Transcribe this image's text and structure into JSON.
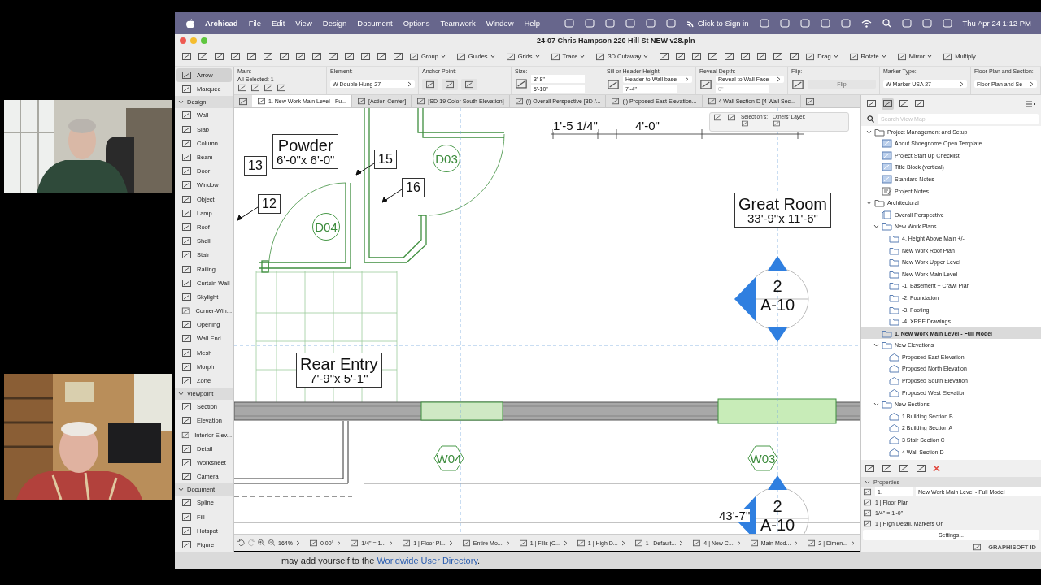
{
  "menubar": {
    "app": "Archicad",
    "menus": [
      "File",
      "Edit",
      "View",
      "Design",
      "Document",
      "Options",
      "Teamwork",
      "Window",
      "Help"
    ],
    "sign_in": "Click to Sign in",
    "clock": "Thu Apr 24 1:12 PM"
  },
  "window": {
    "title": "24-07 Chris Hampson 220 Hill St NEW v28.pln"
  },
  "toolbar": {
    "buttons": [
      "Group",
      "Guides",
      "Grids",
      "Trace",
      "3D Cutaway",
      "Drag",
      "Rotate",
      "Mirror",
      "Multiply..."
    ]
  },
  "info_box": {
    "sections": [
      {
        "kind": "main",
        "label": "Main:",
        "value": "All Selected: 1"
      },
      {
        "kind": "select",
        "label": "Element:",
        "value": "W Double Hung 27"
      },
      {
        "kind": "anchor",
        "label": "Anchor Point:"
      },
      {
        "kind": "fields",
        "label": "Size:",
        "values": [
          "3'-8\"",
          "5'-10\""
        ]
      },
      {
        "kind": "select-field",
        "label": "Sill or Header Height:",
        "value": "Header to Wall base",
        "field": "7'-4\""
      },
      {
        "kind": "select-field",
        "label": "Reveal Depth:",
        "value": "Reveal to Wall Face",
        "placeholder": "0\""
      },
      {
        "kind": "disabled",
        "label": "Flip:",
        "value": "Flip"
      },
      {
        "kind": "select",
        "label": "Marker Type:",
        "value": "W Marker USA 27"
      },
      {
        "kind": "select",
        "label": "Floor Plan and Section:",
        "value": "Floor Plan and Se"
      }
    ]
  },
  "tabs": [
    {
      "label": "1. New Work Main Level - Fu...",
      "selected": true
    },
    {
      "label": "[Action Center]",
      "selected": false
    },
    {
      "label": "[SD-19 Color South Elevation]",
      "selected": false
    },
    {
      "label": "(!) Overall Perspective [3D /...",
      "selected": false
    },
    {
      "label": "(!) Proposed East Elevation...",
      "selected": false
    },
    {
      "label": "4 Wall Section D [4 Wall Sec...",
      "selected": false
    }
  ],
  "toolbox": {
    "items": [
      {
        "label": "Arrow",
        "selected": true
      },
      {
        "label": "Marquee",
        "selected": false
      }
    ],
    "groups": [
      {
        "label": "Design",
        "expanded": true,
        "items": [
          {
            "label": "Wall",
            "selected": false
          },
          {
            "label": "Slab",
            "selected": false
          },
          {
            "label": "Column",
            "selected": false
          },
          {
            "label": "Beam",
            "selected": false
          },
          {
            "label": "Door",
            "selected": false
          },
          {
            "label": "Window",
            "selected": false
          },
          {
            "label": "Object",
            "selected": false
          },
          {
            "label": "Lamp",
            "selected": false
          },
          {
            "label": "Roof",
            "selected": false
          },
          {
            "label": "Shell",
            "selected": false
          },
          {
            "label": "Stair",
            "selected": false
          },
          {
            "label": "Railing",
            "selected": false
          },
          {
            "label": "Curtain Wall",
            "selected": false
          },
          {
            "label": "Skylight",
            "selected": false
          },
          {
            "label": "Corner-Win...",
            "selected": false
          },
          {
            "label": "Opening",
            "selected": false
          },
          {
            "label": "Wall End",
            "selected": false
          },
          {
            "label": "Mesh",
            "selected": false
          },
          {
            "label": "Morph",
            "selected": false
          },
          {
            "label": "Zone",
            "selected": false
          }
        ]
      },
      {
        "label": "Viewpoint",
        "expanded": true,
        "items": [
          {
            "label": "Section",
            "selected": false
          },
          {
            "label": "Elevation",
            "selected": false
          },
          {
            "label": "Interior Elev...",
            "selected": false
          },
          {
            "label": "Detail",
            "selected": false
          },
          {
            "label": "Worksheet",
            "selected": false
          },
          {
            "label": "Camera",
            "selected": false
          }
        ]
      },
      {
        "label": "Document",
        "expanded": true,
        "items": [
          {
            "label": "Spline",
            "selected": false
          },
          {
            "label": "Fill",
            "selected": false
          },
          {
            "label": "Hotspot",
            "selected": false
          },
          {
            "label": "Figure",
            "selected": false
          }
        ]
      }
    ]
  },
  "canvas": {
    "overlay": {
      "selection_label": "Selection's:",
      "layer_label": "Others' Layer:"
    },
    "labels": [
      {
        "kind": "room",
        "name": "Powder",
        "size": "6'-0\"x 6'-0\""
      },
      {
        "kind": "tag",
        "text": "13"
      },
      {
        "kind": "tag",
        "text": "15"
      },
      {
        "kind": "tag",
        "text": "16"
      },
      {
        "kind": "tag",
        "text": "12"
      },
      {
        "kind": "door",
        "text": "D03"
      },
      {
        "kind": "door",
        "text": "D04"
      },
      {
        "kind": "dimension",
        "text": "1'-5 1/4\""
      },
      {
        "kind": "dimension",
        "text": "4'-0\""
      },
      {
        "kind": "room",
        "name": "Great Room",
        "size": "33'-9\"x 11'-6\""
      },
      {
        "kind": "marker",
        "number": "2",
        "sheet": "A-10"
      },
      {
        "kind": "room",
        "name": "Rear Entry",
        "size": "7'-9\"x 5'-1\""
      },
      {
        "kind": "window",
        "text": "W04"
      },
      {
        "kind": "window",
        "text": "W03"
      },
      {
        "kind": "dimension",
        "text": "43'-7\""
      },
      {
        "kind": "marker",
        "number": "2",
        "sheet": "A-10"
      }
    ]
  },
  "status_bar": {
    "items": [
      "164%",
      "0.00°",
      "1/4\" = 1...",
      "1 | Floor Pl...",
      "Entire Mo...",
      "1 | Fills (C...",
      "1 | High D...",
      "1 | Default...",
      "4 | New C...",
      "Main Mod...",
      "2 | Dimen..."
    ]
  },
  "navigator": {
    "search_placeholder": "Search View Map",
    "tree": [
      {
        "label": "Project Management and Setup",
        "kind": "folder",
        "expanded": true,
        "selected": false,
        "children": [
          {
            "label": "About Shoegnome Open Template",
            "kind": "sheet",
            "selected": false
          },
          {
            "label": "Project Start Up Checklist",
            "kind": "sheet",
            "selected": false
          },
          {
            "label": "Title Block (vertical)",
            "kind": "sheet",
            "selected": false
          },
          {
            "label": "Standard Notes",
            "kind": "sheet",
            "selected": false
          },
          {
            "label": "Project Notes",
            "kind": "notes",
            "selected": false
          }
        ]
      },
      {
        "label": "Architectural",
        "kind": "folder",
        "expanded": true,
        "selected": false,
        "children": [
          {
            "label": "Overall Perspective",
            "kind": "perspective",
            "selected": false
          },
          {
            "label": "New Work Plans",
            "kind": "plan",
            "expanded": true,
            "selected": false,
            "children": [
              {
                "label": "4. Height Above Main +/-",
                "kind": "plan",
                "selected": false
              },
              {
                "label": "New Work Roof Plan",
                "kind": "plan",
                "selected": false
              },
              {
                "label": "New Work Upper Level",
                "kind": "plan",
                "selected": false
              },
              {
                "label": "New Work Main Level",
                "kind": "plan",
                "selected": false
              },
              {
                "label": "-1. Basement + Crawl Plan",
                "kind": "plan",
                "selected": false
              },
              {
                "label": "-2. Foundation",
                "kind": "plan",
                "selected": false
              },
              {
                "label": "-3. Footing",
                "kind": "plan",
                "selected": false
              },
              {
                "label": "-4. XREF Drawings",
                "kind": "plan",
                "selected": false
              }
            ]
          },
          {
            "label": "1. New Work Main Level - Full Model",
            "kind": "plan",
            "selected": true
          },
          {
            "label": "New Elevations",
            "kind": "plan",
            "expanded": true,
            "selected": false,
            "children": [
              {
                "label": "Proposed East Elevation",
                "kind": "elevation",
                "selected": false
              },
              {
                "label": "Proposed North Elevation",
                "kind": "elevation",
                "selected": false
              },
              {
                "label": "Proposed South Elevation",
                "kind": "elevation",
                "selected": false
              },
              {
                "label": "Proposed West Elevation",
                "kind": "elevation",
                "selected": false
              }
            ]
          },
          {
            "label": "New Sections",
            "kind": "plan",
            "expanded": true,
            "selected": false,
            "children": [
              {
                "label": "1 Building Section B",
                "kind": "elevation",
                "selected": false
              },
              {
                "label": "2 Building Section A",
                "kind": "elevation",
                "selected": false
              },
              {
                "label": "3 Stair Section C",
                "kind": "elevation",
                "selected": false
              },
              {
                "label": "4 Wall Section D",
                "kind": "elevation",
                "selected": false
              }
            ]
          }
        ]
      }
    ],
    "properties": {
      "title": "Properties",
      "number": "1.",
      "name": "New Work Main Level - Full Model",
      "rows": [
        "1 | Floor Plan",
        "1/4\" = 1'-0\"",
        "1 | High Detail, Markers On"
      ],
      "settings": "Settings..."
    },
    "brand": "GRAPHISOFT ID"
  },
  "footer": {
    "text": "may add yourself to the ",
    "link": "Worldwide User Directory",
    "after": "."
  }
}
